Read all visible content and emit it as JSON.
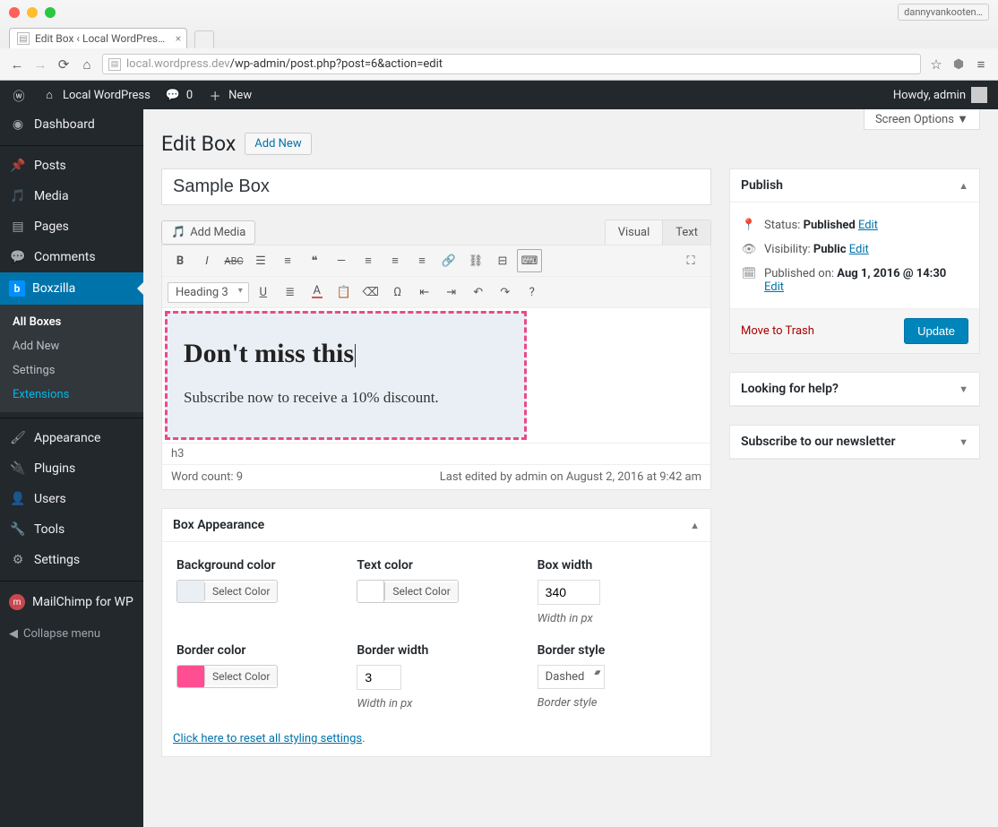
{
  "browser": {
    "tab_title": "Edit Box ‹ Local WordPres…",
    "user_badge": "dannyvankooten…",
    "url_host": "local.wordpress.dev",
    "url_path": "/wp-admin/post.php?post=6&action=edit"
  },
  "adminbar": {
    "site_name": "Local WordPress",
    "comments_count": "0",
    "new_label": "New",
    "howdy": "Howdy, admin"
  },
  "menu": {
    "dashboard": "Dashboard",
    "posts": "Posts",
    "media": "Media",
    "pages": "Pages",
    "comments": "Comments",
    "boxzilla": "Boxzilla",
    "submenu": {
      "all": "All Boxes",
      "add": "Add New",
      "settings": "Settings",
      "ext": "Extensions"
    },
    "appearance": "Appearance",
    "plugins": "Plugins",
    "users": "Users",
    "tools": "Tools",
    "settings": "Settings",
    "mailchimp": "MailChimp for WP",
    "collapse": "Collapse menu"
  },
  "screen_options": "Screen Options  ▼",
  "page": {
    "heading": "Edit Box",
    "add_new": "Add New",
    "title_value": "Sample Box"
  },
  "editor": {
    "add_media": "Add Media",
    "tab_visual": "Visual",
    "tab_text": "Text",
    "format_select": "Heading 3",
    "preview_heading": "Don't miss this",
    "preview_body": "Subscribe now to receive a 10% discount.",
    "path": "h3",
    "word_count": "Word count: 9",
    "last_edited": "Last edited by admin on August 2, 2016 at 9:42 am"
  },
  "publish": {
    "title": "Publish",
    "status_label": "Status:",
    "status_value": "Published",
    "edit": "Edit",
    "visibility_label": "Visibility:",
    "visibility_value": "Public",
    "published_label": "Published on:",
    "published_value": "Aug 1, 2016 @ 14:30",
    "trash": "Move to Trash",
    "update": "Update"
  },
  "side_panels": {
    "help": "Looking for help?",
    "newsletter": "Subscribe to our newsletter"
  },
  "appearance_box": {
    "title": "Box Appearance",
    "bg_label": "Background color",
    "text_label": "Text color",
    "width_label": "Box width",
    "width_value": "340",
    "width_hint": "Width in px",
    "border_color_label": "Border color",
    "border_width_label": "Border width",
    "border_width_value": "3",
    "border_width_hint": "Width in px",
    "border_style_label": "Border style",
    "border_style_value": "Dashed",
    "border_style_hint": "Border style",
    "select_color": "Select Color",
    "reset": "Click here to reset all styling settings"
  }
}
